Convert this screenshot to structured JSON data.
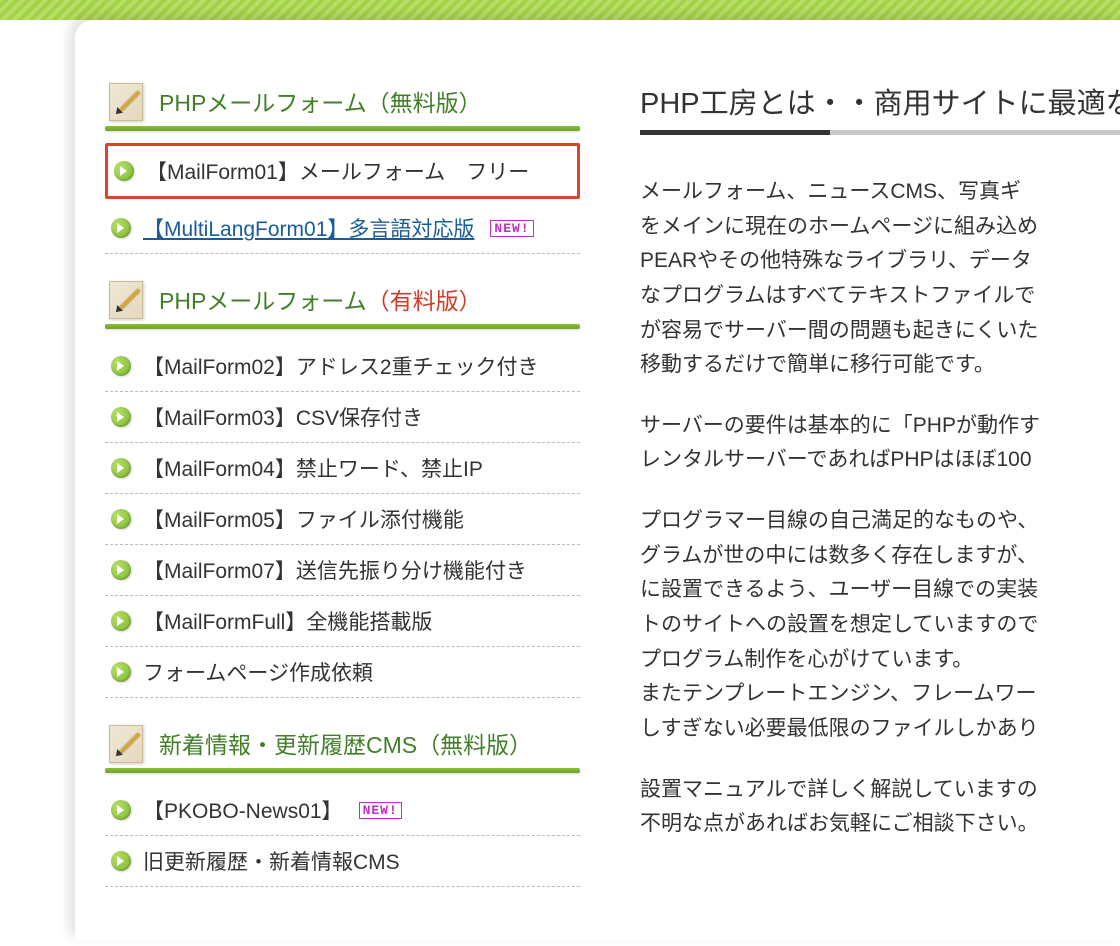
{
  "sidebar": {
    "sections": [
      {
        "title_prefix": "PHPメールフォーム",
        "title_suffix": "（無料版）",
        "paid": false,
        "items": [
          {
            "label": "【MailForm01】メールフォーム　フリー",
            "highlighted": true,
            "underlined": false,
            "new": false
          },
          {
            "label": "【MultiLangForm01】多言語対応版",
            "highlighted": false,
            "underlined": true,
            "new": true
          }
        ]
      },
      {
        "title_prefix": "PHPメールフォーム",
        "title_suffix": "（有料版）",
        "paid": true,
        "items": [
          {
            "label": "【MailForm02】アドレス2重チェック付き",
            "highlighted": false,
            "underlined": false,
            "new": false
          },
          {
            "label": "【MailForm03】CSV保存付き",
            "highlighted": false,
            "underlined": false,
            "new": false
          },
          {
            "label": "【MailForm04】禁止ワード、禁止IP",
            "highlighted": false,
            "underlined": false,
            "new": false
          },
          {
            "label": "【MailForm05】ファイル添付機能",
            "highlighted": false,
            "underlined": false,
            "new": false
          },
          {
            "label": "【MailForm07】送信先振り分け機能付き",
            "highlighted": false,
            "underlined": false,
            "new": false
          },
          {
            "label": "【MailFormFull】全機能搭載版",
            "highlighted": false,
            "underlined": false,
            "new": false
          },
          {
            "label": "フォームページ作成依頼",
            "highlighted": false,
            "underlined": false,
            "new": false
          }
        ]
      },
      {
        "title_prefix": "新着情報・更新履歴CMS",
        "title_suffix": "（無料版）",
        "paid": false,
        "items": [
          {
            "label": "【PKOBO-News01】",
            "highlighted": false,
            "underlined": false,
            "new": true
          },
          {
            "label": "旧更新履歴・新着情報CMS",
            "highlighted": false,
            "underlined": false,
            "new": false
          }
        ]
      }
    ]
  },
  "main": {
    "title": "PHP工房とは・・商用サイトに最適な",
    "paragraphs": [
      "メールフォーム、ニュースCMS、写真ギ\nをメインに現在のホームページに組み込め\nPEARやその他特殊なライブラリ、データ\nなプログラムはすべてテキストファイルで\nが容易でサーバー間の問題も起きにくいた\n移動するだけで簡単に移行可能です。",
      "サーバーの要件は基本的に「PHPが動作す\nレンタルサーバーであればPHPはほぼ100",
      "プログラマー目線の自己満足的なものや、\nグラムが世の中には数多く存在しますが、\nに設置できるよう、ユーザー目線での実装\nトのサイトへの設置を想定していますので\nプログラム制作を心がけています。\nまたテンプレートエンジン、フレームワー\nしすぎない必要最低限のファイルしかあり",
      "設置マニュアルで詳しく解説していますの\n不明な点があればお気軽にご相談下さい。"
    ]
  },
  "new_badge_text": "NEW!"
}
